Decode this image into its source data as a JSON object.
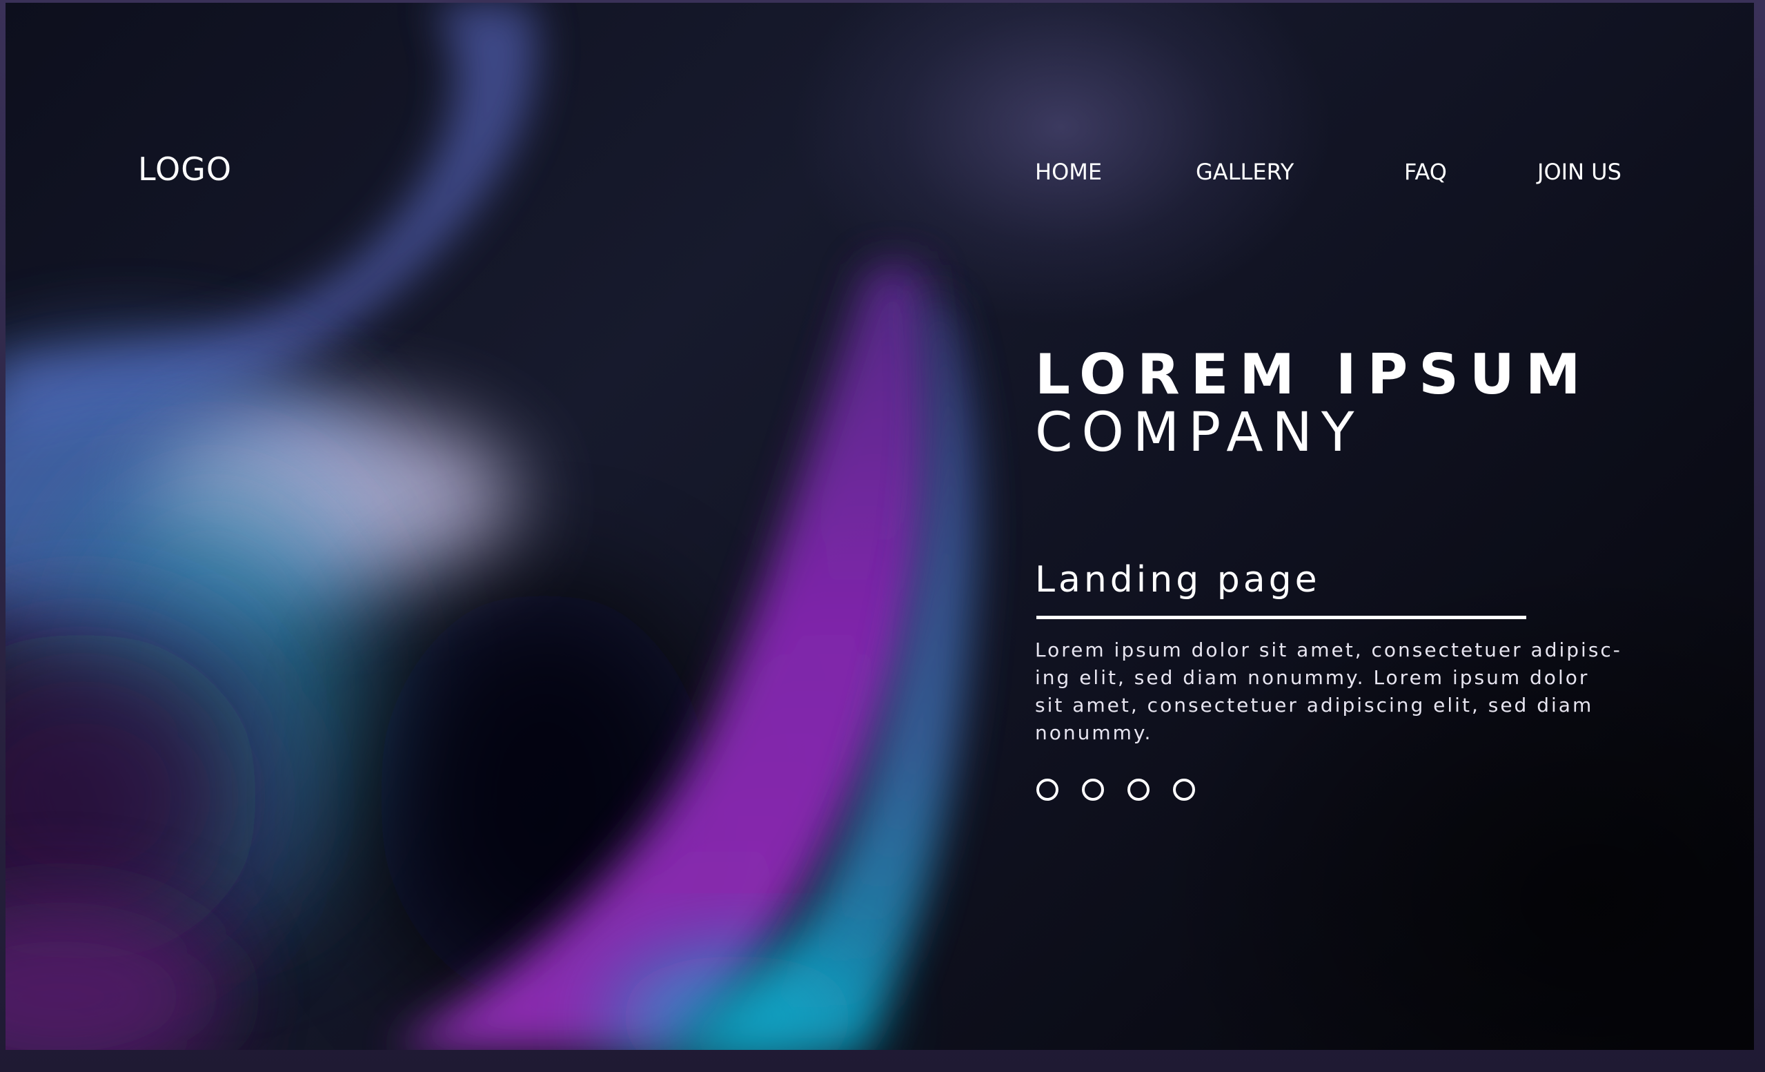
{
  "brand": {
    "logo_text": "LOGO"
  },
  "nav": {
    "items": [
      {
        "label": "HOME"
      },
      {
        "label": "GALLERY"
      },
      {
        "label": "FAQ"
      },
      {
        "label": "JOIN US"
      }
    ]
  },
  "hero": {
    "title_line1": "LOREM IPSUM",
    "title_line2": "COMPANY",
    "subtitle": "Landing page",
    "body_lines": [
      "Lorem ipsum dolor sit amet, consectetuer adipisc-",
      "ing elit, sed diam nonummy. Lorem ipsum dolor",
      "sit amet, consectetuer adipiscing elit, sed diam",
      "nonummy."
    ],
    "pagination_dots": 4
  },
  "colors": {
    "text": "#ffffff",
    "background_dark": "#0d0f1d",
    "accent_purple": "#8a2bb4",
    "accent_cyan": "#1aa0c2",
    "accent_blue": "#4a5ab0"
  }
}
